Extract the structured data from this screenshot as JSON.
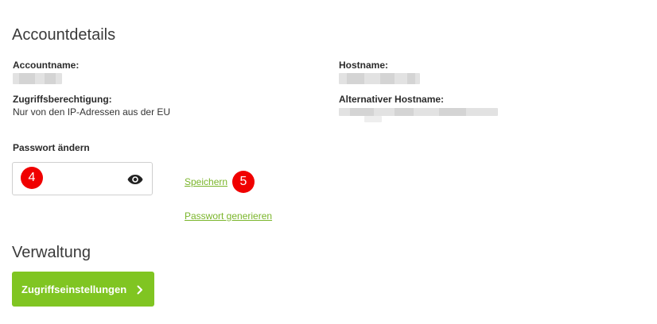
{
  "account": {
    "title": "Accountdetails",
    "accountname_label": "Accountname:",
    "hostname_label": "Hostname:",
    "access_label": "Zugriffsberechtigung:",
    "access_value": "Nur von den IP-Adressen aus der EU",
    "alt_hostname_label": "Alternativer Hostname:"
  },
  "password": {
    "label": "Passwort ändern",
    "value": "",
    "marker": "4",
    "save_link": "Speichern",
    "save_marker": "5",
    "generate_link": "Passwort generieren",
    "visibility_icon": "eye-icon"
  },
  "management": {
    "title": "Verwaltung",
    "button_label": "Zugriffseinstellungen",
    "button_icon": "chevron-right-icon"
  },
  "colors": {
    "accent_green": "#80c522",
    "link_green": "#7ab52a",
    "marker_red": "#f00000"
  }
}
